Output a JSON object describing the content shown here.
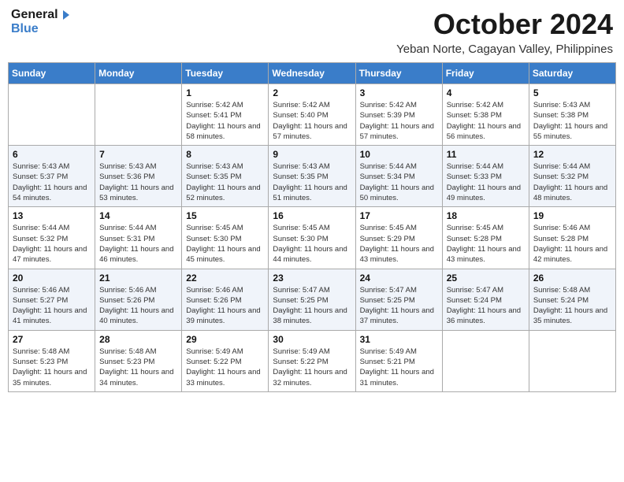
{
  "logo": {
    "line1": "General",
    "line2": "Blue"
  },
  "title": "October 2024",
  "location": "Yeban Norte, Cagayan Valley, Philippines",
  "header_days": [
    "Sunday",
    "Monday",
    "Tuesday",
    "Wednesday",
    "Thursday",
    "Friday",
    "Saturday"
  ],
  "weeks": [
    [
      {
        "day": "",
        "sunrise": "",
        "sunset": "",
        "daylight": ""
      },
      {
        "day": "",
        "sunrise": "",
        "sunset": "",
        "daylight": ""
      },
      {
        "day": "1",
        "sunrise": "Sunrise: 5:42 AM",
        "sunset": "Sunset: 5:41 PM",
        "daylight": "Daylight: 11 hours and 58 minutes."
      },
      {
        "day": "2",
        "sunrise": "Sunrise: 5:42 AM",
        "sunset": "Sunset: 5:40 PM",
        "daylight": "Daylight: 11 hours and 57 minutes."
      },
      {
        "day": "3",
        "sunrise": "Sunrise: 5:42 AM",
        "sunset": "Sunset: 5:39 PM",
        "daylight": "Daylight: 11 hours and 57 minutes."
      },
      {
        "day": "4",
        "sunrise": "Sunrise: 5:42 AM",
        "sunset": "Sunset: 5:38 PM",
        "daylight": "Daylight: 11 hours and 56 minutes."
      },
      {
        "day": "5",
        "sunrise": "Sunrise: 5:43 AM",
        "sunset": "Sunset: 5:38 PM",
        "daylight": "Daylight: 11 hours and 55 minutes."
      }
    ],
    [
      {
        "day": "6",
        "sunrise": "Sunrise: 5:43 AM",
        "sunset": "Sunset: 5:37 PM",
        "daylight": "Daylight: 11 hours and 54 minutes."
      },
      {
        "day": "7",
        "sunrise": "Sunrise: 5:43 AM",
        "sunset": "Sunset: 5:36 PM",
        "daylight": "Daylight: 11 hours and 53 minutes."
      },
      {
        "day": "8",
        "sunrise": "Sunrise: 5:43 AM",
        "sunset": "Sunset: 5:35 PM",
        "daylight": "Daylight: 11 hours and 52 minutes."
      },
      {
        "day": "9",
        "sunrise": "Sunrise: 5:43 AM",
        "sunset": "Sunset: 5:35 PM",
        "daylight": "Daylight: 11 hours and 51 minutes."
      },
      {
        "day": "10",
        "sunrise": "Sunrise: 5:44 AM",
        "sunset": "Sunset: 5:34 PM",
        "daylight": "Daylight: 11 hours and 50 minutes."
      },
      {
        "day": "11",
        "sunrise": "Sunrise: 5:44 AM",
        "sunset": "Sunset: 5:33 PM",
        "daylight": "Daylight: 11 hours and 49 minutes."
      },
      {
        "day": "12",
        "sunrise": "Sunrise: 5:44 AM",
        "sunset": "Sunset: 5:32 PM",
        "daylight": "Daylight: 11 hours and 48 minutes."
      }
    ],
    [
      {
        "day": "13",
        "sunrise": "Sunrise: 5:44 AM",
        "sunset": "Sunset: 5:32 PM",
        "daylight": "Daylight: 11 hours and 47 minutes."
      },
      {
        "day": "14",
        "sunrise": "Sunrise: 5:44 AM",
        "sunset": "Sunset: 5:31 PM",
        "daylight": "Daylight: 11 hours and 46 minutes."
      },
      {
        "day": "15",
        "sunrise": "Sunrise: 5:45 AM",
        "sunset": "Sunset: 5:30 PM",
        "daylight": "Daylight: 11 hours and 45 minutes."
      },
      {
        "day": "16",
        "sunrise": "Sunrise: 5:45 AM",
        "sunset": "Sunset: 5:30 PM",
        "daylight": "Daylight: 11 hours and 44 minutes."
      },
      {
        "day": "17",
        "sunrise": "Sunrise: 5:45 AM",
        "sunset": "Sunset: 5:29 PM",
        "daylight": "Daylight: 11 hours and 43 minutes."
      },
      {
        "day": "18",
        "sunrise": "Sunrise: 5:45 AM",
        "sunset": "Sunset: 5:28 PM",
        "daylight": "Daylight: 11 hours and 43 minutes."
      },
      {
        "day": "19",
        "sunrise": "Sunrise: 5:46 AM",
        "sunset": "Sunset: 5:28 PM",
        "daylight": "Daylight: 11 hours and 42 minutes."
      }
    ],
    [
      {
        "day": "20",
        "sunrise": "Sunrise: 5:46 AM",
        "sunset": "Sunset: 5:27 PM",
        "daylight": "Daylight: 11 hours and 41 minutes."
      },
      {
        "day": "21",
        "sunrise": "Sunrise: 5:46 AM",
        "sunset": "Sunset: 5:26 PM",
        "daylight": "Daylight: 11 hours and 40 minutes."
      },
      {
        "day": "22",
        "sunrise": "Sunrise: 5:46 AM",
        "sunset": "Sunset: 5:26 PM",
        "daylight": "Daylight: 11 hours and 39 minutes."
      },
      {
        "day": "23",
        "sunrise": "Sunrise: 5:47 AM",
        "sunset": "Sunset: 5:25 PM",
        "daylight": "Daylight: 11 hours and 38 minutes."
      },
      {
        "day": "24",
        "sunrise": "Sunrise: 5:47 AM",
        "sunset": "Sunset: 5:25 PM",
        "daylight": "Daylight: 11 hours and 37 minutes."
      },
      {
        "day": "25",
        "sunrise": "Sunrise: 5:47 AM",
        "sunset": "Sunset: 5:24 PM",
        "daylight": "Daylight: 11 hours and 36 minutes."
      },
      {
        "day": "26",
        "sunrise": "Sunrise: 5:48 AM",
        "sunset": "Sunset: 5:24 PM",
        "daylight": "Daylight: 11 hours and 35 minutes."
      }
    ],
    [
      {
        "day": "27",
        "sunrise": "Sunrise: 5:48 AM",
        "sunset": "Sunset: 5:23 PM",
        "daylight": "Daylight: 11 hours and 35 minutes."
      },
      {
        "day": "28",
        "sunrise": "Sunrise: 5:48 AM",
        "sunset": "Sunset: 5:23 PM",
        "daylight": "Daylight: 11 hours and 34 minutes."
      },
      {
        "day": "29",
        "sunrise": "Sunrise: 5:49 AM",
        "sunset": "Sunset: 5:22 PM",
        "daylight": "Daylight: 11 hours and 33 minutes."
      },
      {
        "day": "30",
        "sunrise": "Sunrise: 5:49 AM",
        "sunset": "Sunset: 5:22 PM",
        "daylight": "Daylight: 11 hours and 32 minutes."
      },
      {
        "day": "31",
        "sunrise": "Sunrise: 5:49 AM",
        "sunset": "Sunset: 5:21 PM",
        "daylight": "Daylight: 11 hours and 31 minutes."
      },
      {
        "day": "",
        "sunrise": "",
        "sunset": "",
        "daylight": ""
      },
      {
        "day": "",
        "sunrise": "",
        "sunset": "",
        "daylight": ""
      }
    ]
  ]
}
